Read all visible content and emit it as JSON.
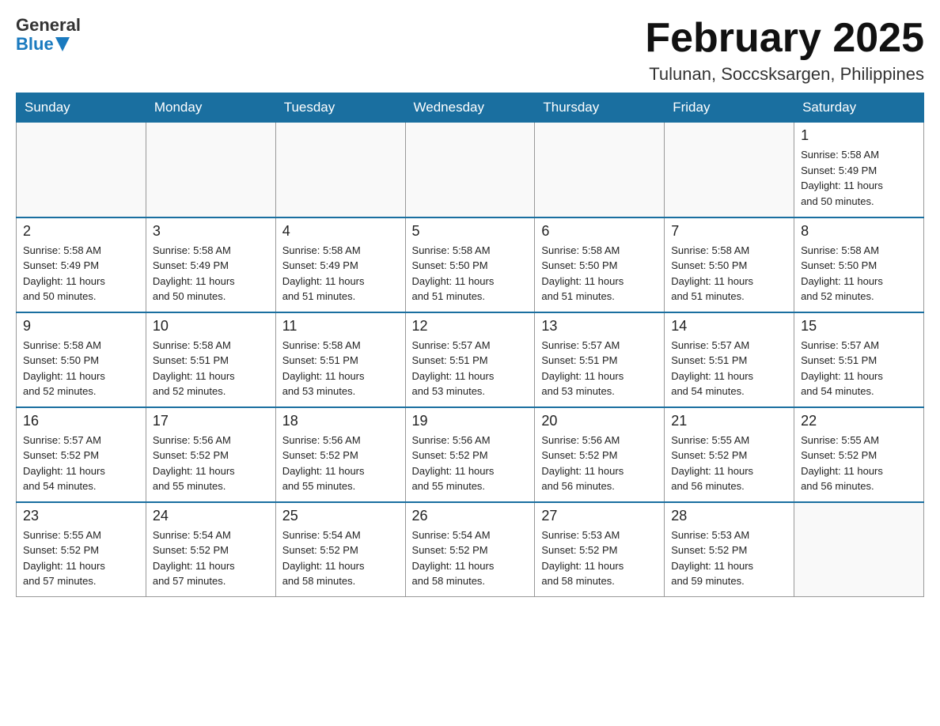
{
  "header": {
    "logo": {
      "text_general": "General",
      "text_blue": "Blue",
      "arrow_unicode": "▼"
    },
    "title": "February 2025",
    "location": "Tulunan, Soccsksargen, Philippines"
  },
  "days_of_week": [
    "Sunday",
    "Monday",
    "Tuesday",
    "Wednesday",
    "Thursday",
    "Friday",
    "Saturday"
  ],
  "weeks": [
    {
      "days": [
        {
          "number": "",
          "info": ""
        },
        {
          "number": "",
          "info": ""
        },
        {
          "number": "",
          "info": ""
        },
        {
          "number": "",
          "info": ""
        },
        {
          "number": "",
          "info": ""
        },
        {
          "number": "",
          "info": ""
        },
        {
          "number": "1",
          "info": "Sunrise: 5:58 AM\nSunset: 5:49 PM\nDaylight: 11 hours\nand 50 minutes."
        }
      ]
    },
    {
      "days": [
        {
          "number": "2",
          "info": "Sunrise: 5:58 AM\nSunset: 5:49 PM\nDaylight: 11 hours\nand 50 minutes."
        },
        {
          "number": "3",
          "info": "Sunrise: 5:58 AM\nSunset: 5:49 PM\nDaylight: 11 hours\nand 50 minutes."
        },
        {
          "number": "4",
          "info": "Sunrise: 5:58 AM\nSunset: 5:49 PM\nDaylight: 11 hours\nand 51 minutes."
        },
        {
          "number": "5",
          "info": "Sunrise: 5:58 AM\nSunset: 5:50 PM\nDaylight: 11 hours\nand 51 minutes."
        },
        {
          "number": "6",
          "info": "Sunrise: 5:58 AM\nSunset: 5:50 PM\nDaylight: 11 hours\nand 51 minutes."
        },
        {
          "number": "7",
          "info": "Sunrise: 5:58 AM\nSunset: 5:50 PM\nDaylight: 11 hours\nand 51 minutes."
        },
        {
          "number": "8",
          "info": "Sunrise: 5:58 AM\nSunset: 5:50 PM\nDaylight: 11 hours\nand 52 minutes."
        }
      ]
    },
    {
      "days": [
        {
          "number": "9",
          "info": "Sunrise: 5:58 AM\nSunset: 5:50 PM\nDaylight: 11 hours\nand 52 minutes."
        },
        {
          "number": "10",
          "info": "Sunrise: 5:58 AM\nSunset: 5:51 PM\nDaylight: 11 hours\nand 52 minutes."
        },
        {
          "number": "11",
          "info": "Sunrise: 5:58 AM\nSunset: 5:51 PM\nDaylight: 11 hours\nand 53 minutes."
        },
        {
          "number": "12",
          "info": "Sunrise: 5:57 AM\nSunset: 5:51 PM\nDaylight: 11 hours\nand 53 minutes."
        },
        {
          "number": "13",
          "info": "Sunrise: 5:57 AM\nSunset: 5:51 PM\nDaylight: 11 hours\nand 53 minutes."
        },
        {
          "number": "14",
          "info": "Sunrise: 5:57 AM\nSunset: 5:51 PM\nDaylight: 11 hours\nand 54 minutes."
        },
        {
          "number": "15",
          "info": "Sunrise: 5:57 AM\nSunset: 5:51 PM\nDaylight: 11 hours\nand 54 minutes."
        }
      ]
    },
    {
      "days": [
        {
          "number": "16",
          "info": "Sunrise: 5:57 AM\nSunset: 5:52 PM\nDaylight: 11 hours\nand 54 minutes."
        },
        {
          "number": "17",
          "info": "Sunrise: 5:56 AM\nSunset: 5:52 PM\nDaylight: 11 hours\nand 55 minutes."
        },
        {
          "number": "18",
          "info": "Sunrise: 5:56 AM\nSunset: 5:52 PM\nDaylight: 11 hours\nand 55 minutes."
        },
        {
          "number": "19",
          "info": "Sunrise: 5:56 AM\nSunset: 5:52 PM\nDaylight: 11 hours\nand 55 minutes."
        },
        {
          "number": "20",
          "info": "Sunrise: 5:56 AM\nSunset: 5:52 PM\nDaylight: 11 hours\nand 56 minutes."
        },
        {
          "number": "21",
          "info": "Sunrise: 5:55 AM\nSunset: 5:52 PM\nDaylight: 11 hours\nand 56 minutes."
        },
        {
          "number": "22",
          "info": "Sunrise: 5:55 AM\nSunset: 5:52 PM\nDaylight: 11 hours\nand 56 minutes."
        }
      ]
    },
    {
      "days": [
        {
          "number": "23",
          "info": "Sunrise: 5:55 AM\nSunset: 5:52 PM\nDaylight: 11 hours\nand 57 minutes."
        },
        {
          "number": "24",
          "info": "Sunrise: 5:54 AM\nSunset: 5:52 PM\nDaylight: 11 hours\nand 57 minutes."
        },
        {
          "number": "25",
          "info": "Sunrise: 5:54 AM\nSunset: 5:52 PM\nDaylight: 11 hours\nand 58 minutes."
        },
        {
          "number": "26",
          "info": "Sunrise: 5:54 AM\nSunset: 5:52 PM\nDaylight: 11 hours\nand 58 minutes."
        },
        {
          "number": "27",
          "info": "Sunrise: 5:53 AM\nSunset: 5:52 PM\nDaylight: 11 hours\nand 58 minutes."
        },
        {
          "number": "28",
          "info": "Sunrise: 5:53 AM\nSunset: 5:52 PM\nDaylight: 11 hours\nand 59 minutes."
        },
        {
          "number": "",
          "info": ""
        }
      ]
    }
  ]
}
